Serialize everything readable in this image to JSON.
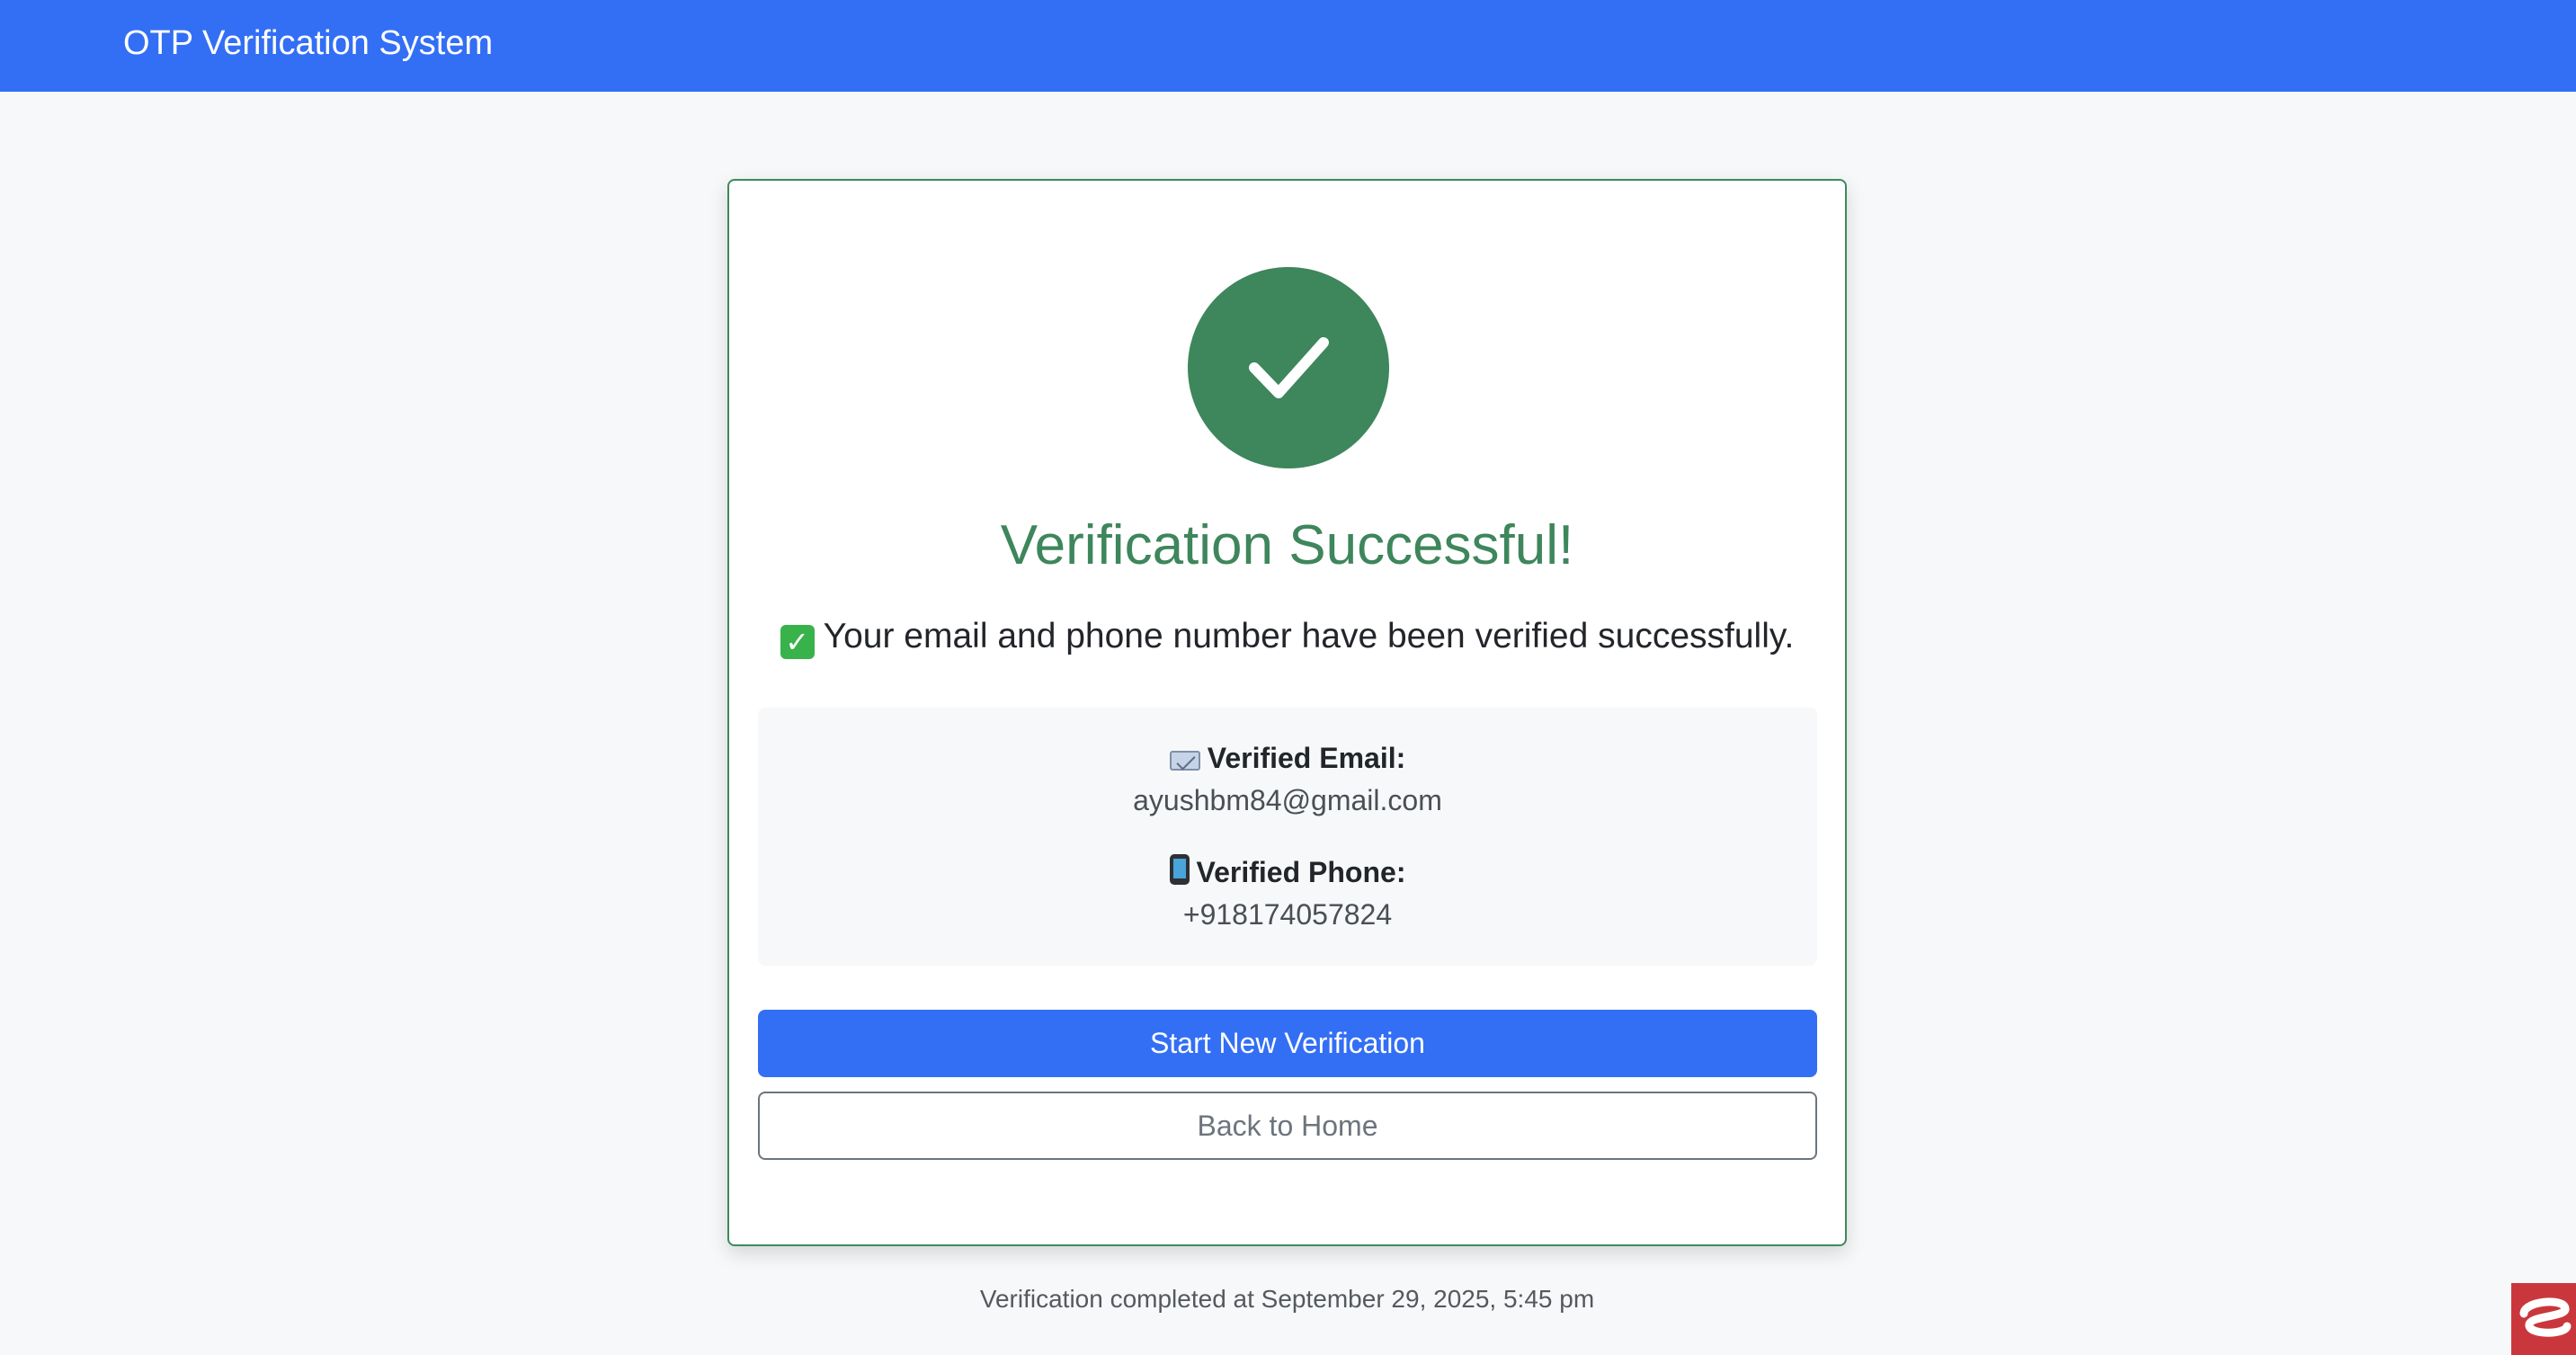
{
  "header": {
    "brand": "OTP Verification System"
  },
  "success": {
    "title": "Verification Successful!",
    "message": "Your email and phone number have been verified successfully.",
    "message_icon": "check-mark-emoji"
  },
  "details": {
    "email_label": "Verified Email:",
    "email_value": "ayushbm84@gmail.com",
    "email_icon": "email-icon",
    "phone_label": "Verified Phone:",
    "phone_value": "+918174057824",
    "phone_icon": "mobile-phone-icon"
  },
  "actions": {
    "primary_label": "Start New Verification",
    "secondary_label": "Back to Home"
  },
  "footer": {
    "completed_text": "Verification completed at September 29, 2025, 5:45 pm"
  },
  "colors": {
    "nav_blue": "#336ff5",
    "success_green": "#3e865b",
    "secondary_gray": "#6c757d",
    "page_bg": "#f7f8fa"
  }
}
